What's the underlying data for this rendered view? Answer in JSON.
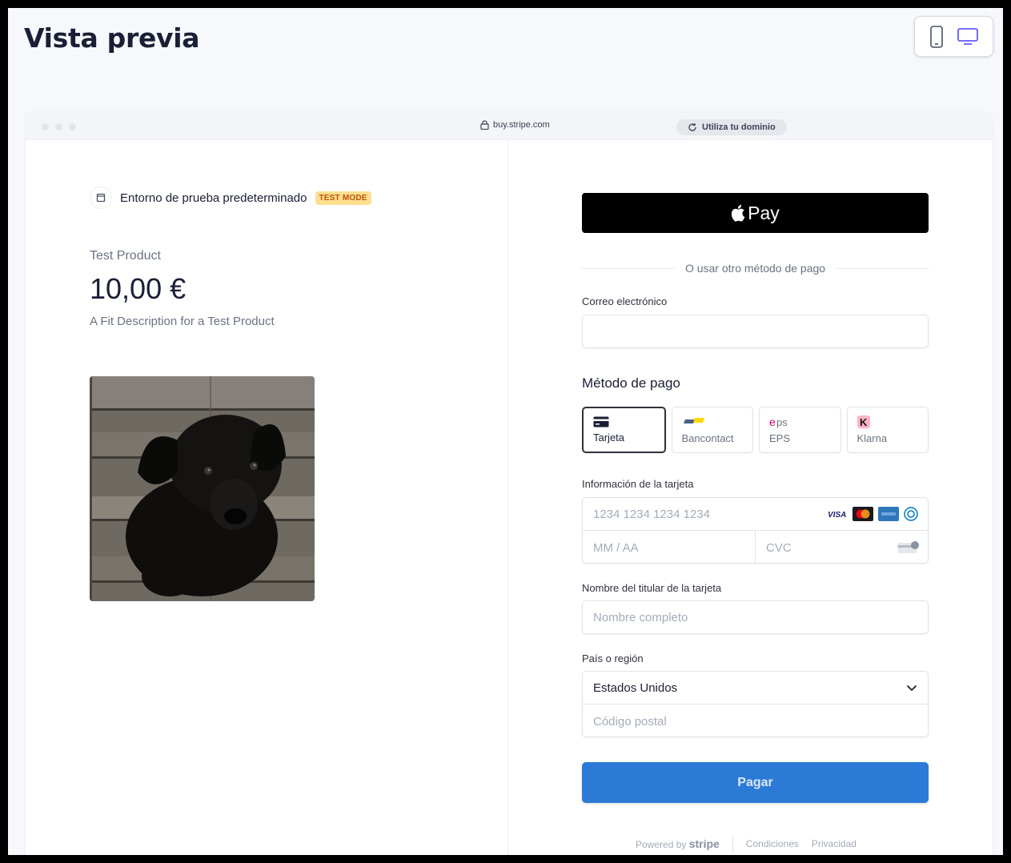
{
  "header": {
    "title": "Vista previa"
  },
  "browser": {
    "url": "buy.stripe.com",
    "domain_pill": "Utiliza tu dominio"
  },
  "left": {
    "environment": "Entorno de prueba predeterminado",
    "badge": "TEST MODE",
    "product_name": "Test Product",
    "price": "10,00 €",
    "description": "A Fit Description for a Test Product"
  },
  "right": {
    "apple_pay": "Pay",
    "or_text": "O usar otro método de pago",
    "email_label": "Correo electrónico",
    "email_value": "",
    "payment_method_title": "Método de pago",
    "methods": [
      {
        "label": "Tarjeta",
        "icon": "card-icon",
        "active": true
      },
      {
        "label": "Bancontact",
        "icon": "bancontact-icon",
        "active": false
      },
      {
        "label": "EPS",
        "icon": "eps-icon",
        "active": false
      },
      {
        "label": "Klarna",
        "icon": "klarna-icon",
        "active": false
      }
    ],
    "card_label": "Información de la tarjeta",
    "card_number_placeholder": "1234 1234 1234 1234",
    "expiry_placeholder": "MM / AA",
    "cvc_placeholder": "CVC",
    "cardholder_label": "Nombre del titular de la tarjeta",
    "cardholder_placeholder": "Nombre completo",
    "country_label": "País o región",
    "country_value": "Estados Unidos",
    "postal_placeholder": "Código postal",
    "pay_button": "Pagar"
  },
  "footer": {
    "powered_by": "Powered by",
    "stripe": "stripe",
    "terms": "Condiciones",
    "privacy": "Privacidad"
  },
  "colors": {
    "pay_button": "#2d7ad6",
    "badge_bg": "#ffde92",
    "badge_text": "#bb5504"
  }
}
